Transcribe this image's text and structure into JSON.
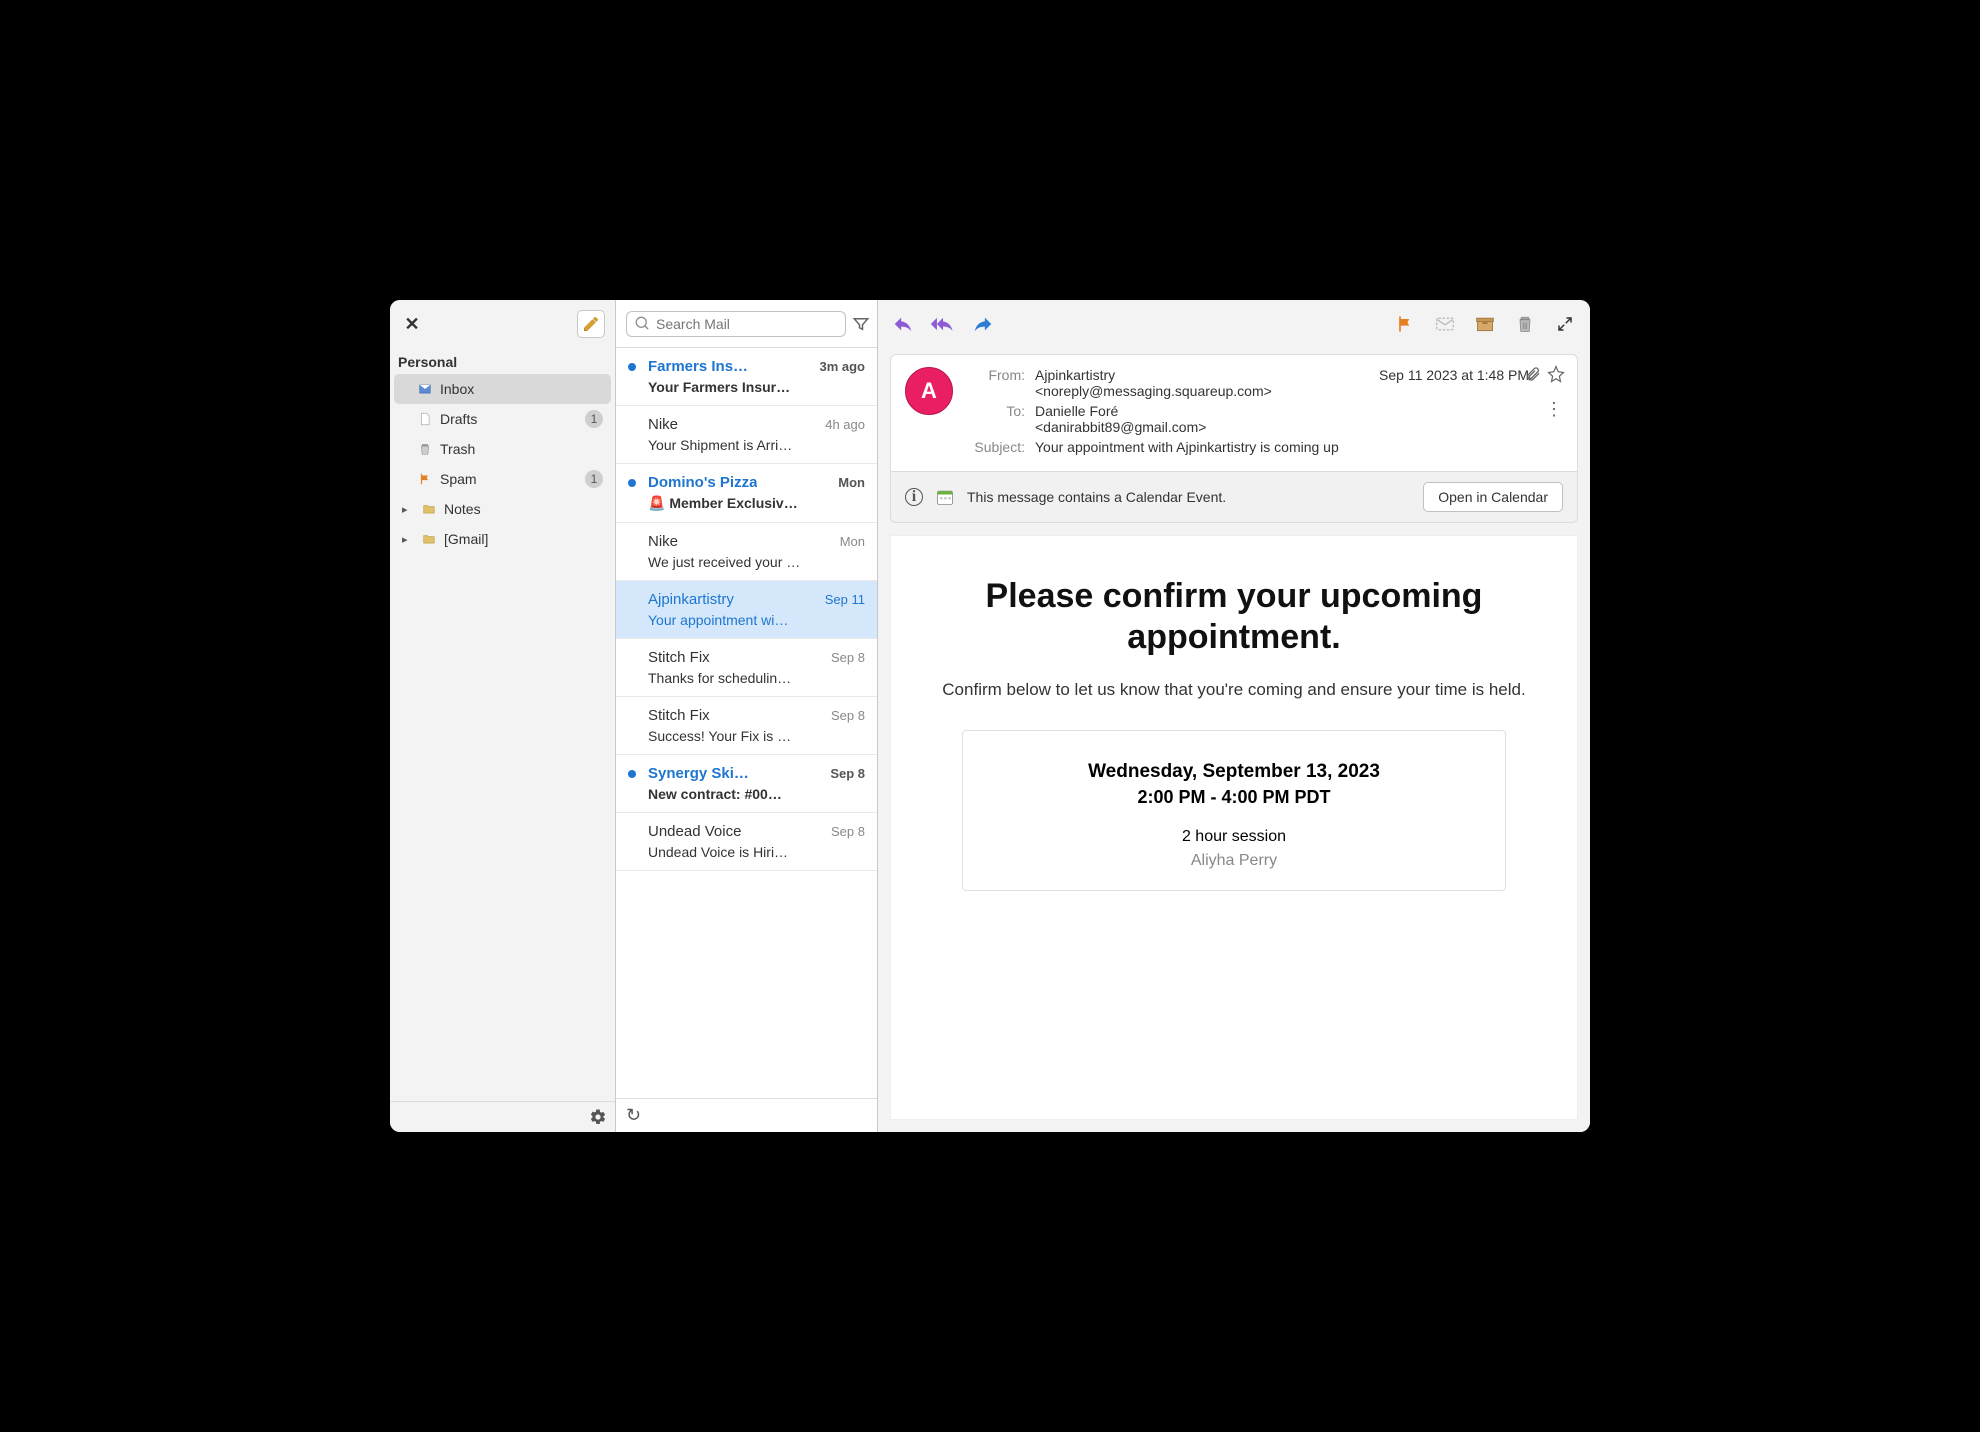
{
  "sidebar": {
    "section_title": "Personal",
    "folders": [
      {
        "name": "Inbox",
        "icon": "inbox",
        "selected": true,
        "badge": null,
        "expandable": false
      },
      {
        "name": "Drafts",
        "icon": "draft",
        "selected": false,
        "badge": "1",
        "expandable": false
      },
      {
        "name": "Trash",
        "icon": "trash",
        "selected": false,
        "badge": null,
        "expandable": false
      },
      {
        "name": "Spam",
        "icon": "flag",
        "selected": false,
        "badge": "1",
        "expandable": false
      },
      {
        "name": "Notes",
        "icon": "folder",
        "selected": false,
        "badge": null,
        "expandable": true
      },
      {
        "name": "[Gmail]",
        "icon": "folder",
        "selected": false,
        "badge": null,
        "expandable": true
      }
    ]
  },
  "search": {
    "placeholder": "Search Mail"
  },
  "messages": [
    {
      "sender": "Farmers Ins…",
      "time": "3m ago",
      "subject": "Your Farmers Insur…",
      "unread": true,
      "selected": false
    },
    {
      "sender": "Nike",
      "time": "4h ago",
      "subject": "Your Shipment is Arri…",
      "unread": false,
      "selected": false
    },
    {
      "sender": "Domino's Pizza",
      "time": "Mon",
      "subject": "🚨 Member Exclusiv…",
      "unread": true,
      "selected": false
    },
    {
      "sender": "Nike",
      "time": "Mon",
      "subject": "We just received your …",
      "unread": false,
      "selected": false
    },
    {
      "sender": "Ajpinkartistry",
      "time": "Sep 11",
      "subject": "Your appointment wi…",
      "unread": false,
      "selected": true
    },
    {
      "sender": "Stitch Fix",
      "time": "Sep  8",
      "subject": "Thanks for schedulin…",
      "unread": false,
      "selected": false
    },
    {
      "sender": "Stitch Fix",
      "time": "Sep  8",
      "subject": "Success! Your Fix is …",
      "unread": false,
      "selected": false
    },
    {
      "sender": "Synergy Ski…",
      "time": "Sep  8",
      "subject": "New contract: #00…",
      "unread": true,
      "selected": false
    },
    {
      "sender": "Undead Voice",
      "time": "Sep  8",
      "subject": "Undead Voice is Hiri…",
      "unread": false,
      "selected": false
    }
  ],
  "header": {
    "avatar_letter": "A",
    "from_label": "From:",
    "from_name": "Ajpinkartistry",
    "from_addr": "<noreply@messaging.squareup.com>",
    "to_label": "To:",
    "to_name": "Danielle Foré",
    "to_addr": "<danirabbit89@gmail.com>",
    "subject_label": "Subject:",
    "subject": "Your appointment with Ajpinkartistry is coming up",
    "date": "Sep 11 2023 at 1:48 PM"
  },
  "calendar_bar": {
    "text": "This message contains a Calendar Event.",
    "button": "Open in Calendar"
  },
  "body": {
    "title": "Please confirm your upcoming appointment.",
    "subtitle": "Confirm below to let us know that you're coming and ensure your time is held.",
    "appt_date": "Wednesday, September 13, 2023",
    "appt_time": "2:00 PM - 4:00 PM PDT",
    "appt_dur": "2 hour session",
    "appt_person": "Aliyha Perry"
  }
}
